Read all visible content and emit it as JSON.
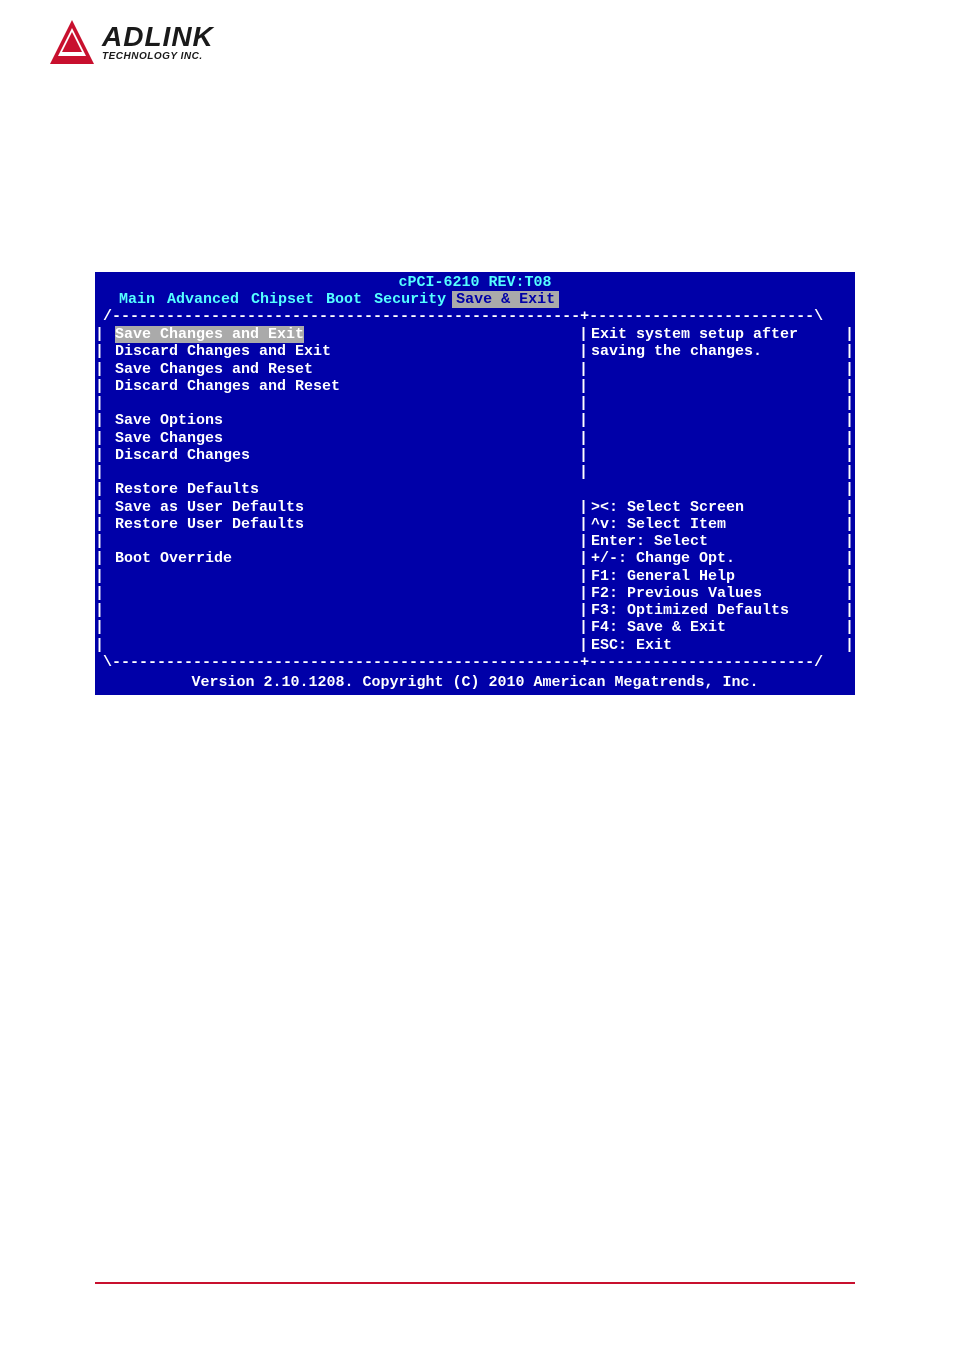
{
  "logo": {
    "main": "ADLINK",
    "sub": "TECHNOLOGY INC."
  },
  "bios": {
    "title": "cPCI-6210 REV:T08",
    "tabs": [
      "Main",
      "Advanced",
      "Chipset",
      "Boot",
      "Security",
      "Save & Exit"
    ],
    "active_tab": 5,
    "options_group1": [
      "Save Changes and Exit",
      "Discard Changes and Exit",
      "Save Changes and Reset",
      "Discard Changes and Reset"
    ],
    "options_group2_header": "Save Options",
    "options_group2": [
      "Save Changes",
      "Discard Changes"
    ],
    "options_group3": [
      "Restore Defaults",
      "Save as User Defaults",
      "Restore User Defaults"
    ],
    "options_group4": [
      "Boot Override"
    ],
    "help_text": [
      "Exit system setup after",
      "saving the changes."
    ],
    "key_hints": [
      "><: Select Screen",
      "^v: Select Item",
      "Enter: Select",
      "+/-: Change Opt.",
      "F1: General Help",
      "F2: Previous Values",
      "F3: Optimized Defaults",
      "F4: Save & Exit",
      "ESC: Exit"
    ],
    "footer": "Version 2.10.1208. Copyright (C) 2010 American Megatrends, Inc."
  }
}
